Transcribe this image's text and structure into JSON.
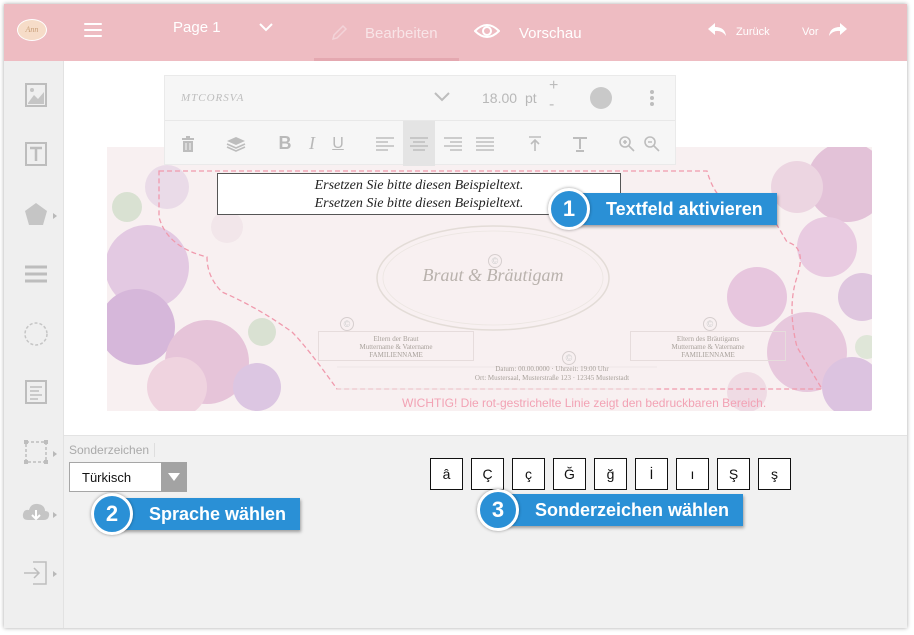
{
  "topbar": {
    "logo_text": "Ann",
    "page_label": "Page 1",
    "edit_label": "Bearbeiten",
    "preview_label": "Vorschau",
    "back_label": "Zurück",
    "forward_label": "Vor"
  },
  "toolbar": {
    "font_name": "MTCORSVA",
    "font_size": "18.00",
    "font_unit": "pt",
    "size_plus": "+",
    "size_minus": "-",
    "bold": "B",
    "italic": "I",
    "underline": "U",
    "text_color": "#c9c9c9"
  },
  "card": {
    "text_line_1": "Ersetzen Sie bitte diesen Beispieltext.",
    "text_line_2": "Ersetzen Sie bitte diesen Beispieltext.",
    "bride_groom": "Braut & Bräutigam",
    "bride_parents": {
      "title": "Eltern der Braut",
      "names": "Muttername & Vatername",
      "family": "FAMILIENNAME"
    },
    "groom_parents": {
      "title": "Eltern des Bräutigams",
      "names": "Muttername & Vatername",
      "family": "FAMILIENNAME"
    },
    "date_line": "Datum: 00.00.0000 · Uhrzeit: 19:00 Uhr",
    "place_line": "Ort: Mustersaal, Musterstraße 123 · 12345 Musterstadt",
    "copyright_mark": "©",
    "warning": "WICHTIG!  Die rot-gestrichelte Linie zeigt den bedruckbaren Bereich."
  },
  "callouts": [
    {
      "num": "1",
      "label": "Textfeld aktivieren"
    },
    {
      "num": "2",
      "label": "Sprache wählen"
    },
    {
      "num": "3",
      "label": "Sonderzeichen wählen"
    }
  ],
  "bottom": {
    "section_label": "Sonderzeichen",
    "language_value": "Türkisch",
    "chars": [
      "â",
      "Ç",
      "ç",
      "Ğ",
      "ğ",
      "İ",
      "ı",
      "Ş",
      "ş"
    ]
  },
  "colors": {
    "topbar": "#eebcc2",
    "callout": "#2a90d6",
    "warning": "#f2a2b4"
  }
}
